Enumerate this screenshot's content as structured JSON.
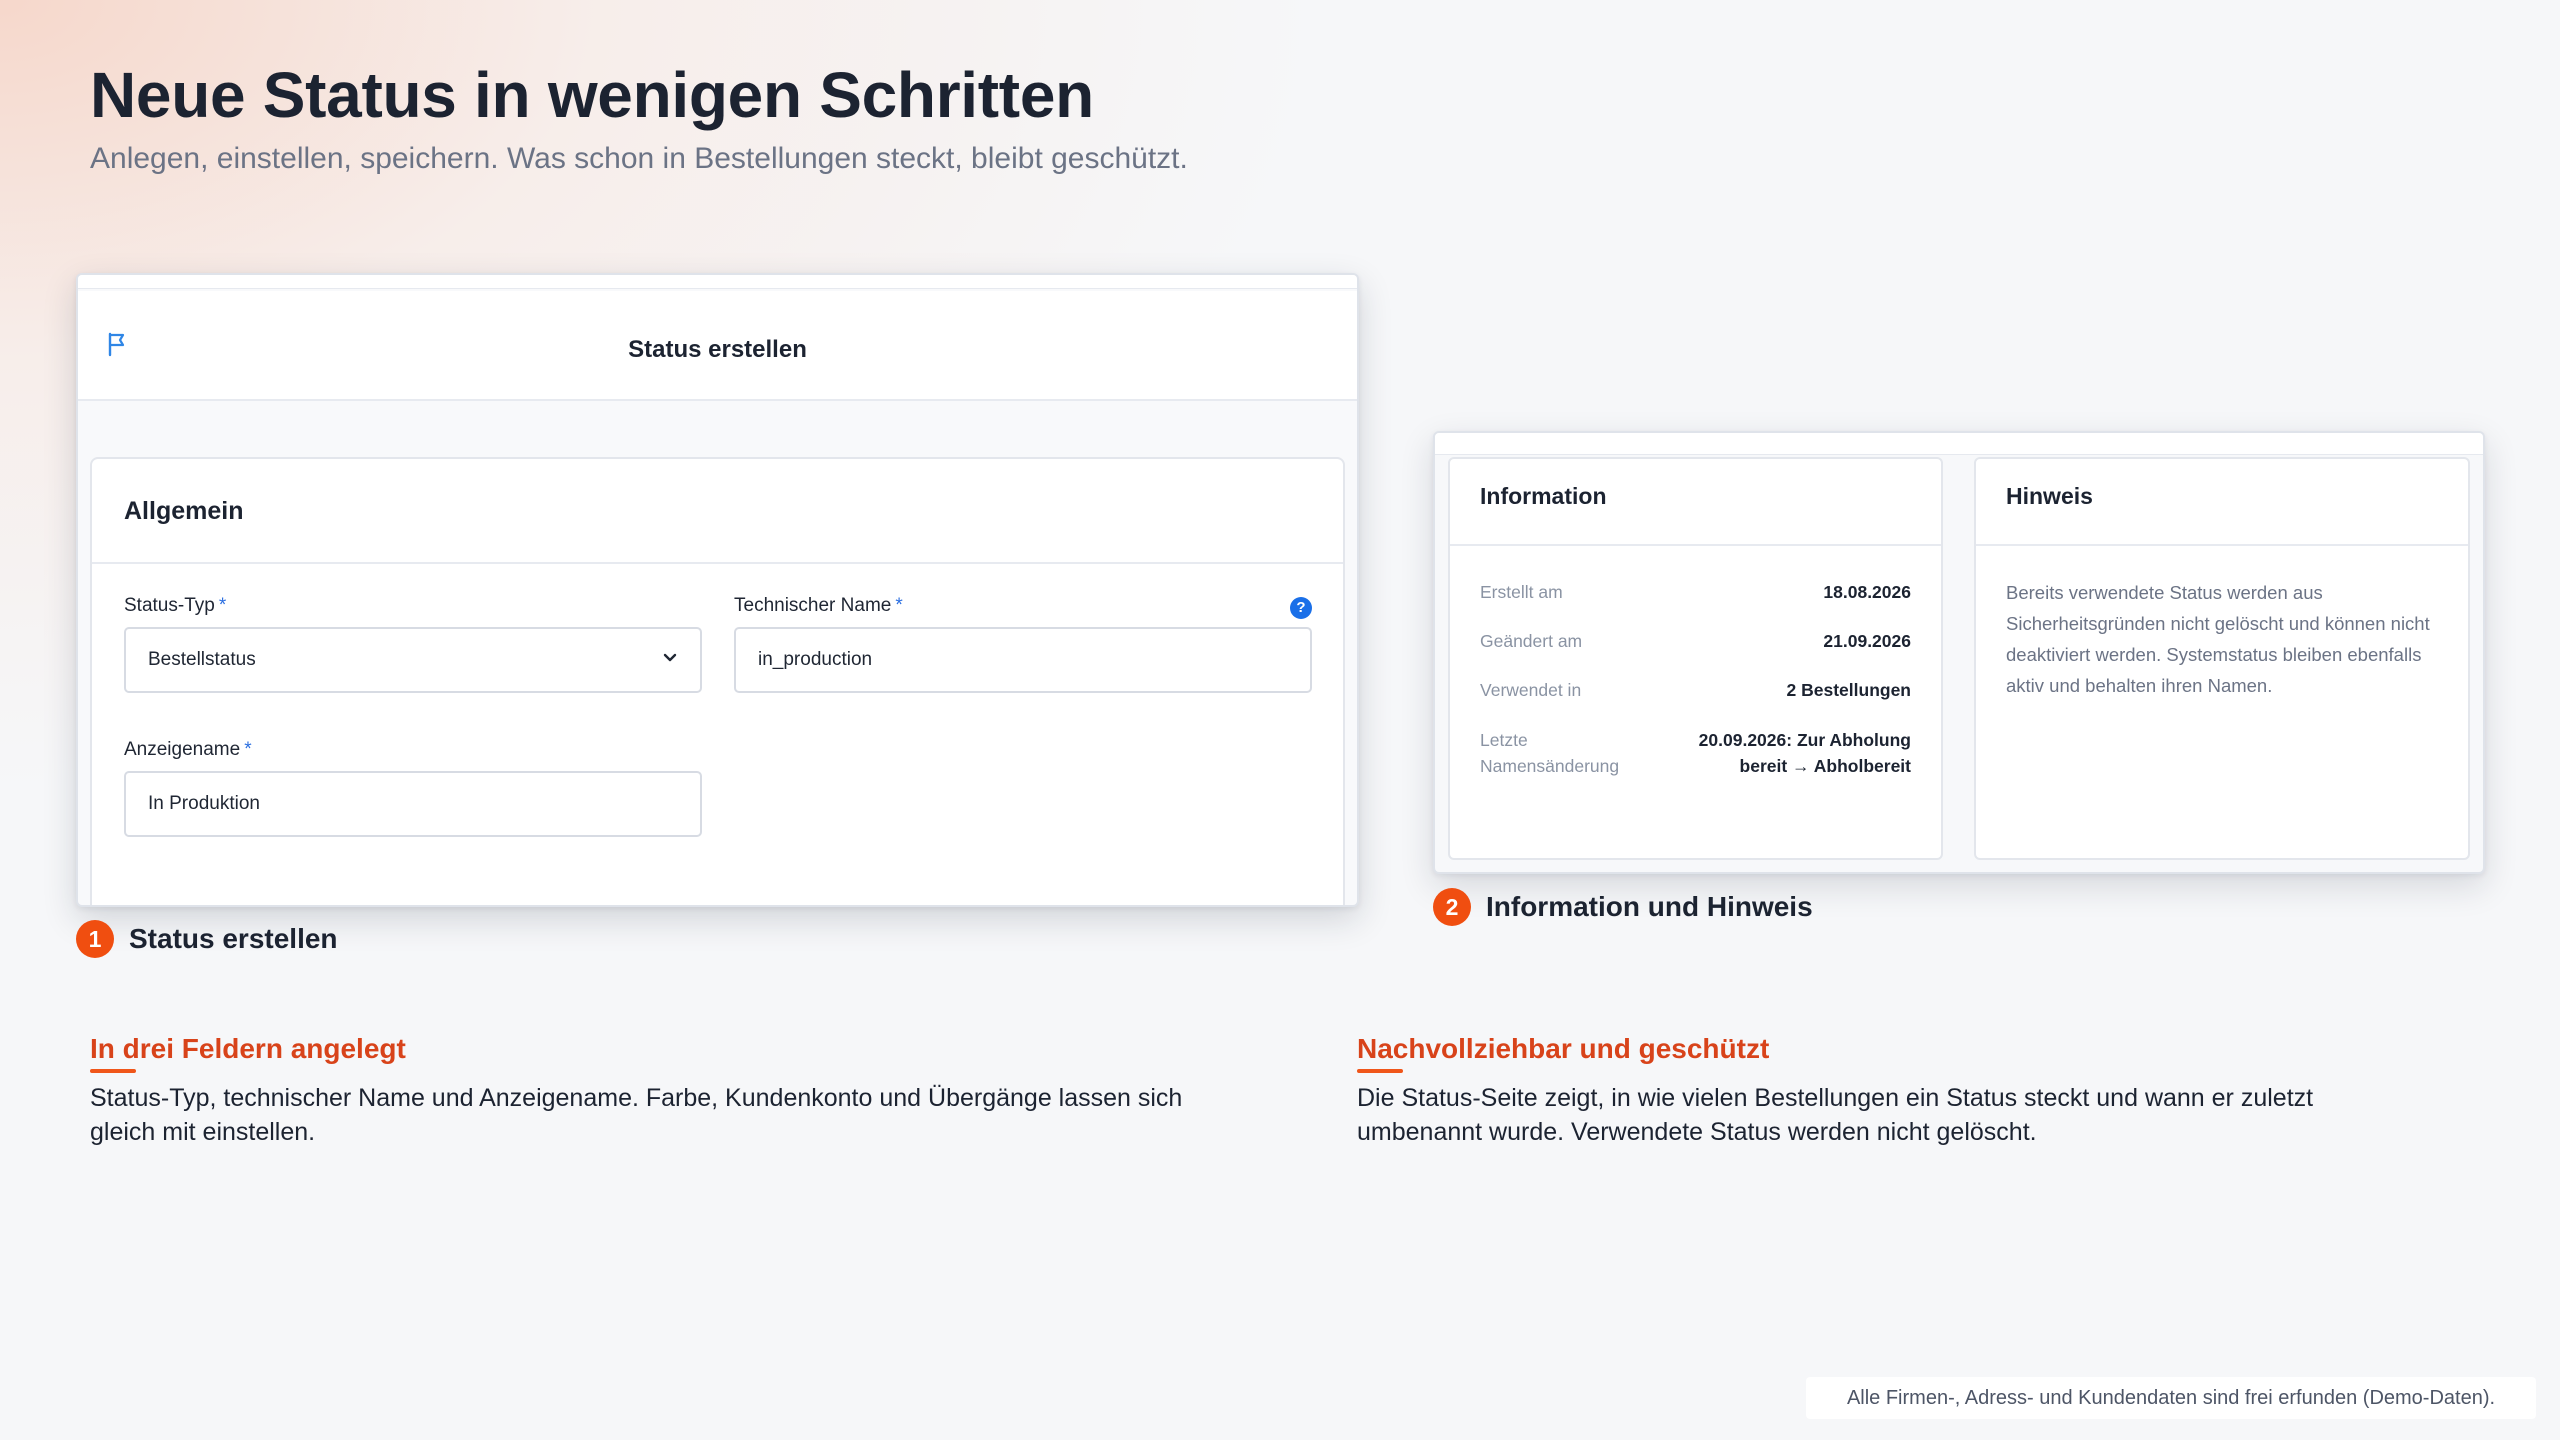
{
  "hero": {
    "title": "Neue Status in wenigen Schritten",
    "subtitle": "Anlegen, einstellen, speichern. Was schon in Bestellungen steckt, bleibt geschützt."
  },
  "modal": {
    "title": "Status erstellen",
    "section_title": "Allgemein",
    "fields": {
      "status_type": {
        "label": "Status-Typ",
        "required": "*",
        "value": "Bestellstatus"
      },
      "technical_name": {
        "label": "Technischer Name",
        "required": "*",
        "value": "in_production",
        "help": "?"
      },
      "display_name": {
        "label": "Anzeigename",
        "required": "*",
        "value": "In Produktion"
      }
    }
  },
  "info_panel": {
    "title": "Information",
    "rows": [
      {
        "key": "Erstellt am",
        "value": "18.08.2026"
      },
      {
        "key": "Geändert am",
        "value": "21.09.2026"
      },
      {
        "key": "Verwendet in",
        "value": "2 Bestellungen"
      },
      {
        "key": "Letzte Namensänderung",
        "value": "20.09.2026: Zur Abholung bereit → Abholbereit"
      }
    ]
  },
  "note_panel": {
    "title": "Hinweis",
    "text": "Bereits verwendete Status werden aus Sicherheitsgründen nicht gelöscht und können nicht deaktiviert werden. Systemstatus bleiben ebenfalls aktiv und behalten ihren Namen."
  },
  "steps": [
    {
      "number": "1",
      "label": "Status erstellen"
    },
    {
      "number": "2",
      "label": "Information und Hinweis"
    }
  ],
  "features": [
    {
      "title": "In drei Feldern angelegt",
      "body": "Status-Typ, technischer Name und Anzeigename. Farbe, Kundenkonto und Übergänge lassen sich gleich mit einstellen."
    },
    {
      "title": "Nachvollziehbar und geschützt",
      "body": "Die Status-Seite zeigt, in wie vielen Bestellungen ein Status steckt und wann er zuletzt umbenannt wurde. Verwendete Status werden nicht gelöscht."
    }
  ],
  "footnote": "Alle Firmen-, Adress- und Kundendaten sind frei erfunden (Demo-Daten).",
  "colors": {
    "accent": "#f04e10",
    "feature_title": "#d8431a",
    "link_blue": "#1a6fe8",
    "text_dark": "#1c2331",
    "text_muted": "#6b7385"
  }
}
